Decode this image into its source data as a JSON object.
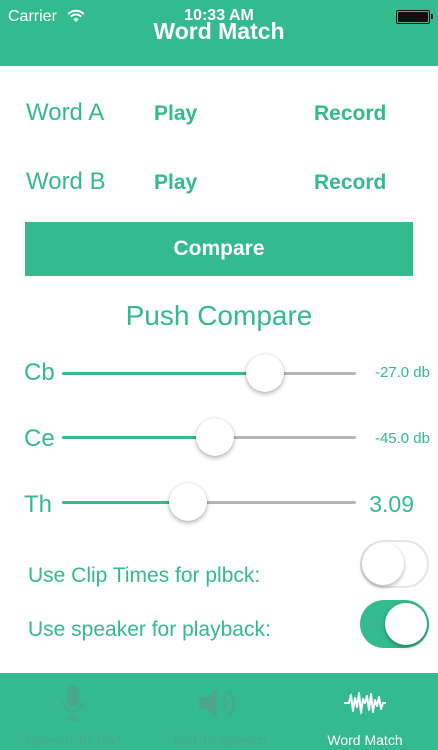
{
  "status_bar": {
    "carrier": "Carrier",
    "time": "10:33 AM"
  },
  "header": {
    "title": "Word Match"
  },
  "words": [
    {
      "label": "Word A",
      "play": "Play",
      "record": "Record"
    },
    {
      "label": "Word B",
      "play": "Play",
      "record": "Record"
    }
  ],
  "compare_label": "Compare",
  "status_message": "Push Compare",
  "sliders": [
    {
      "label": "Cb",
      "value": "-27.0 db",
      "fraction": 0.69
    },
    {
      "label": "Ce",
      "value": "-45.0 db",
      "fraction": 0.52
    },
    {
      "label": "Th",
      "value": "3.09",
      "fraction": 0.43
    }
  ],
  "switches": [
    {
      "label": "Use Clip Times for plbck:",
      "on": false
    },
    {
      "label": "Use speaker for playback:",
      "on": true
    }
  ],
  "tabs": [
    {
      "label": "Speech To Text",
      "icon": "microphone-icon",
      "active": false
    },
    {
      "label": "Text To Speech",
      "icon": "speaker-icon",
      "active": false
    },
    {
      "label": "Word Match",
      "icon": "waveform-icon",
      "active": true
    }
  ],
  "colors": {
    "accent": "#33ba8e",
    "track": "#b5b5b5",
    "tab_inactive": "#48a889",
    "tab_active": "#ffffff"
  }
}
